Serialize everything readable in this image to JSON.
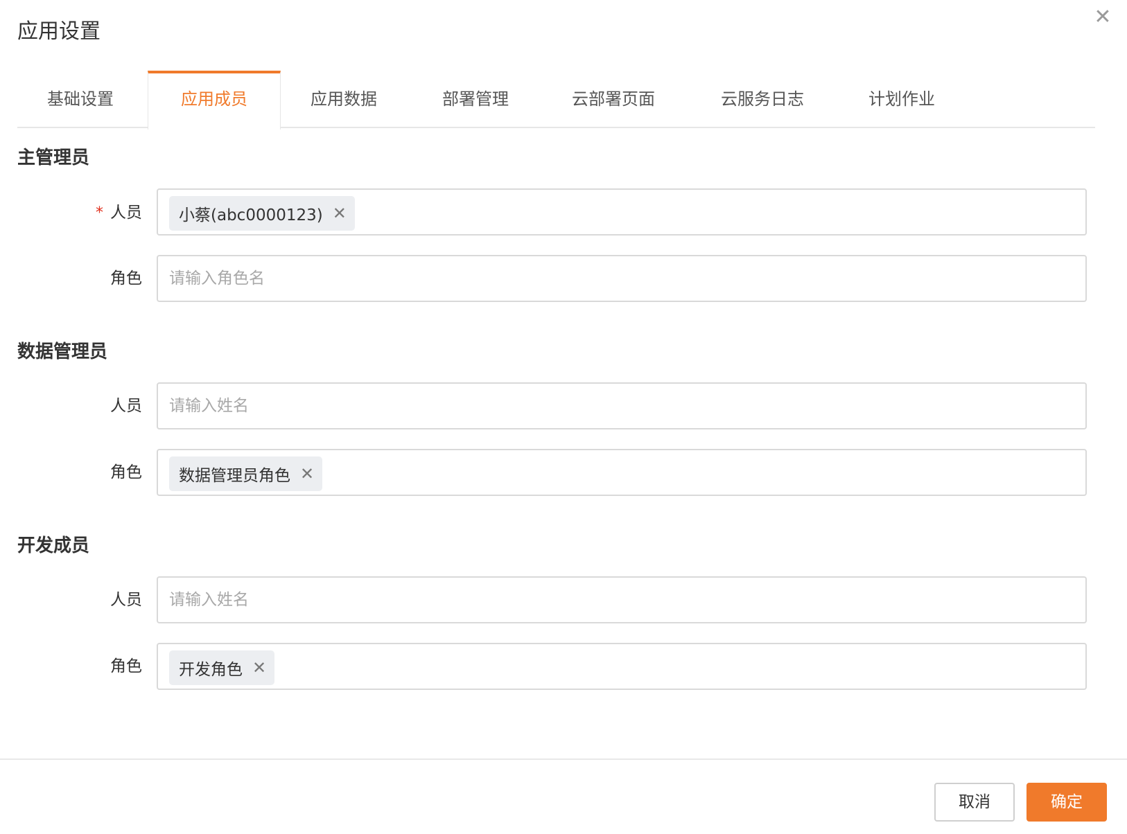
{
  "dialog": {
    "title": "应用设置",
    "close_icon": "close-icon"
  },
  "tabs": [
    {
      "label": "基础设置",
      "active": false
    },
    {
      "label": "应用成员",
      "active": true
    },
    {
      "label": "应用数据",
      "active": false
    },
    {
      "label": "部署管理",
      "active": false
    },
    {
      "label": "云部署页面",
      "active": false
    },
    {
      "label": "云服务日志",
      "active": false
    },
    {
      "label": "计划作业",
      "active": false
    }
  ],
  "sections": {
    "main_admin": {
      "title": "主管理员",
      "person_label": "人员",
      "person_required": "*",
      "person_tag": "小蔡(abc0000123)",
      "role_label": "角色",
      "role_placeholder": "请输入角色名"
    },
    "data_admin": {
      "title": "数据管理员",
      "person_label": "人员",
      "person_placeholder": "请输入姓名",
      "role_label": "角色",
      "role_tag": "数据管理员角色"
    },
    "dev_member": {
      "title": "开发成员",
      "person_label": "人员",
      "person_placeholder": "请输入姓名",
      "role_label": "角色",
      "role_tag": "开发角色"
    }
  },
  "footer": {
    "cancel_label": "取消",
    "ok_label": "确定"
  },
  "colors": {
    "accent": "#f07a2b",
    "required": "#e0301e",
    "tag_bg": "#eceef1",
    "border": "#d9d9d9"
  },
  "tag_close_glyph": "✕"
}
